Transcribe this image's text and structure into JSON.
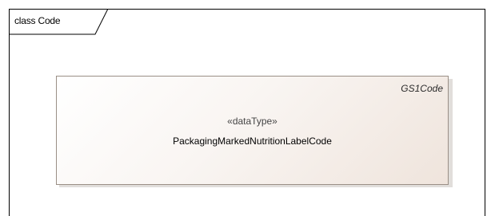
{
  "diagram": {
    "frame_label": "class Code",
    "class": {
      "stereotype": "«dataType»",
      "name": "PackagingMarkedNutritionLabelCode",
      "tag": "GS1Code"
    }
  },
  "colors": {
    "frame_border": "#000000",
    "class_border": "#9a8f86",
    "class_fill_start": "#ffffff",
    "class_fill_end": "#efe4dc"
  }
}
